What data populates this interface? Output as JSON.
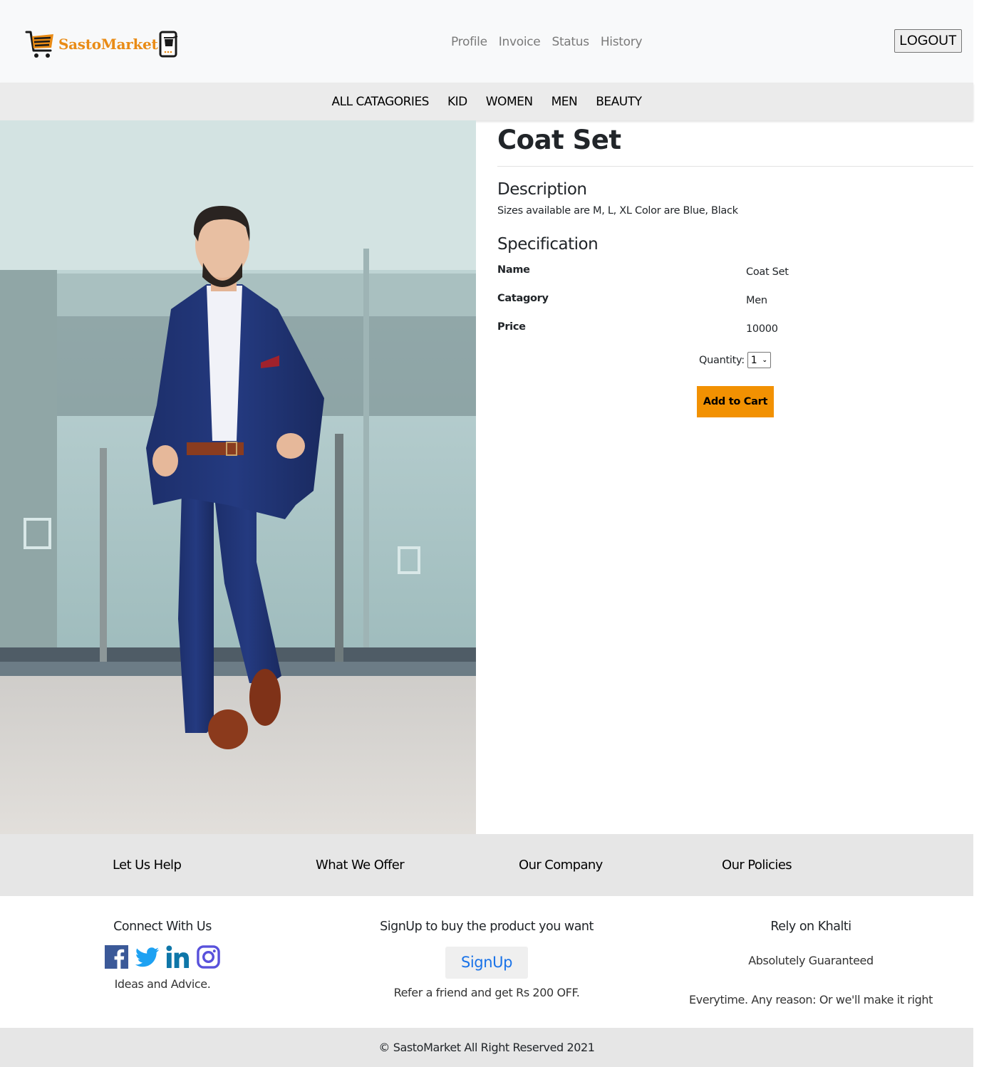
{
  "brand": {
    "name": "SastoMarket",
    "accent_color": "#e98b15"
  },
  "header": {
    "nav": [
      {
        "label": "Profile"
      },
      {
        "label": "Invoice"
      },
      {
        "label": "Status"
      },
      {
        "label": "History"
      }
    ],
    "logout_label": "LOGOUT"
  },
  "categories": [
    {
      "label": "ALL CATAGORIES"
    },
    {
      "label": "KID"
    },
    {
      "label": "WOMEN"
    },
    {
      "label": "MEN"
    },
    {
      "label": "BEAUTY"
    }
  ],
  "product": {
    "image_alt": "Man in navy blue suit with white shirt and brown shoes walking",
    "title": "Coat Set",
    "description_heading": "Description",
    "description": "Sizes available are M, L, XL Color are Blue, Black",
    "specification_heading": "Specification",
    "specs": [
      {
        "label": "Name",
        "value": "Coat Set"
      },
      {
        "label": "Catagory",
        "value": "Men"
      },
      {
        "label": "Price",
        "value": "10000"
      }
    ],
    "quantity_label": "Quantity:",
    "quantity_value": "1",
    "add_to_cart_label": "Add to Cart",
    "add_to_cart_color": "#f29102"
  },
  "footer": {
    "links": [
      {
        "label": "Let Us Help"
      },
      {
        "label": "What We Offer"
      },
      {
        "label": "Our Company"
      },
      {
        "label": "Our Policies"
      }
    ],
    "connect": {
      "title": "Connect With Us",
      "socials": [
        {
          "icon": "facebook-icon",
          "color": "#3b5998"
        },
        {
          "icon": "twitter-icon",
          "color": "#1da1f2"
        },
        {
          "icon": "linkedin-icon",
          "color": "#0e76a8"
        },
        {
          "icon": "instagram-icon",
          "color": "#5851db"
        }
      ],
      "tagline": "Ideas and Advice."
    },
    "signup": {
      "title": "SignUp to buy the product you want",
      "button_label": "SignUp",
      "note": "Refer a friend and get Rs 200 OFF."
    },
    "khalti": {
      "title": "Rely on Khalti",
      "line1": "Absolutely Guaranteed",
      "line2": "Everytime. Any reason: Or we'll make it right"
    },
    "copyright": "© SastoMarket All Right Reserved 2021"
  }
}
